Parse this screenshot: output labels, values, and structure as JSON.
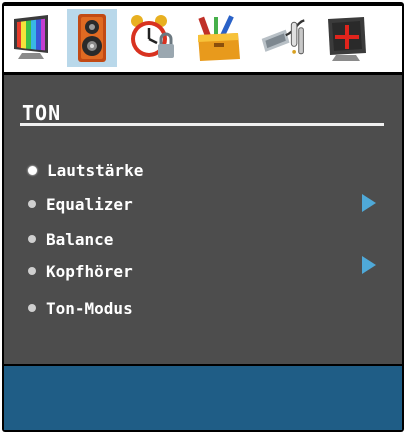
{
  "icons": [
    {
      "name": "picture-icon",
      "active": false
    },
    {
      "name": "sound-icon",
      "active": true
    },
    {
      "name": "alarm-clock-icon",
      "active": false
    },
    {
      "name": "toolbox-icon",
      "active": false
    },
    {
      "name": "source-cable-icon",
      "active": false
    },
    {
      "name": "crosshair-icon",
      "active": false
    }
  ],
  "menu": {
    "title": "TON",
    "items": [
      {
        "label": "Lautstärke",
        "selected": true,
        "submenu": false
      },
      {
        "label": "Equalizer",
        "selected": false,
        "submenu": true
      },
      {
        "label": "Balance",
        "selected": false,
        "submenu": false
      },
      {
        "label": "Kopfhörer",
        "selected": false,
        "submenu": true
      },
      {
        "label": "Ton-Modus",
        "selected": false,
        "submenu": false
      }
    ]
  },
  "colors": {
    "panel": "#4d4d4d",
    "footer": "#1f5d86",
    "active_tab": "#b9d8ea",
    "arrow": "#4fa9d8"
  }
}
